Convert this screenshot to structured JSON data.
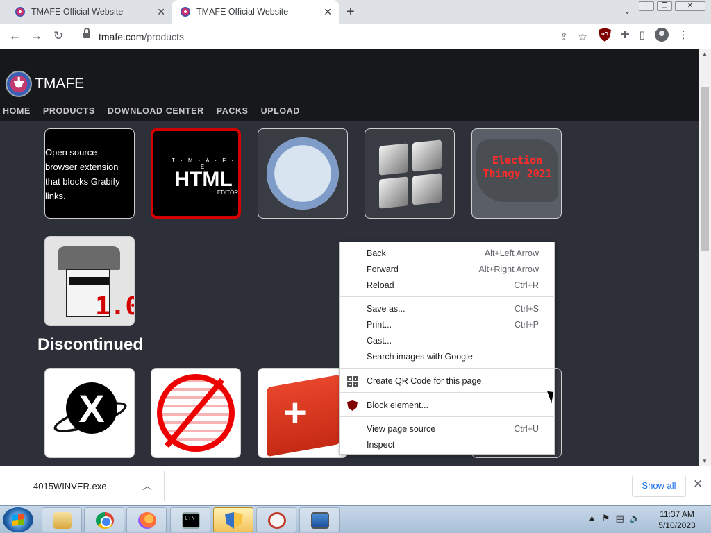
{
  "tabs": [
    {
      "title": "TMAFE Official Website",
      "active": false
    },
    {
      "title": "TMAFE Official Website",
      "active": true
    }
  ],
  "toolbar": {
    "url_host": "tmafe.com",
    "url_path": "/products",
    "extension_label": "uO"
  },
  "site": {
    "brand": "TMAFE",
    "nav": [
      "HOME",
      "PRODUCTS",
      "DOWNLOAD CENTER",
      "PACKS",
      "UPLOAD"
    ],
    "tile_text": "Open source browser extension that blocks Grabify links.",
    "html_editor": {
      "line1": "T · M · A · F · E",
      "line2": "HTML",
      "line3": "EDITOR"
    },
    "election_label": "Election Thingy 2021",
    "spy_version": "1.0",
    "section_title": "Discontinued"
  },
  "context_menu": {
    "items": [
      {
        "label": "Back",
        "shortcut": "Alt+Left Arrow"
      },
      {
        "label": "Forward",
        "shortcut": "Alt+Right Arrow"
      },
      {
        "label": "Reload",
        "shortcut": "Ctrl+R"
      },
      {
        "label": "Save as...",
        "shortcut": "Ctrl+S"
      },
      {
        "label": "Print...",
        "shortcut": "Ctrl+P"
      },
      {
        "label": "Cast...",
        "shortcut": ""
      },
      {
        "label": "Search images with Google",
        "shortcut": ""
      },
      {
        "label": "Create QR Code for this page",
        "shortcut": "",
        "icon": "qr-code-icon"
      },
      {
        "label": "Block element...",
        "shortcut": "",
        "icon": "ublock-icon"
      },
      {
        "label": "View page source",
        "shortcut": "Ctrl+U"
      },
      {
        "label": "Inspect",
        "shortcut": ""
      }
    ]
  },
  "downloads": {
    "file": "4015WINVER.exe",
    "show_all": "Show all"
  },
  "taskbar": {
    "time": "11:37 AM",
    "date": "5/10/2023"
  },
  "colors": {
    "page_bg": "#2d3039",
    "header_bg": "#17181b",
    "accent_red": "#d40000",
    "link_blue": "#1a73e8"
  }
}
